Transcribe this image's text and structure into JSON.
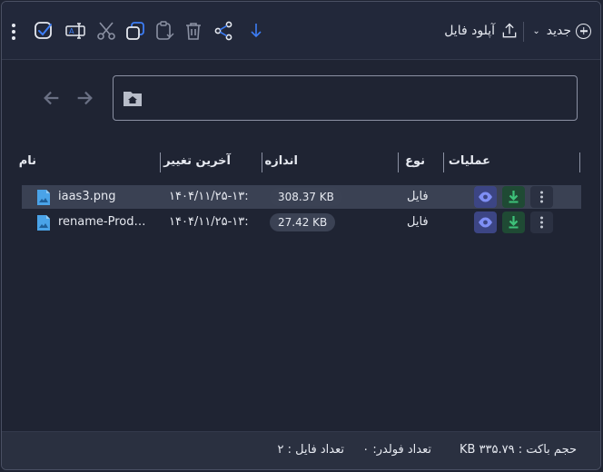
{
  "toolbar": {
    "new_label": "جدید",
    "upload_label": "آپلود فایل",
    "icons": [
      "more-vertical-icon",
      "select-all-icon",
      "rename-icon",
      "cut-icon",
      "copy-icon",
      "paste-icon",
      "delete-icon",
      "share-icon",
      "download-icon",
      "upload-icon",
      "plus-circle-icon",
      "chevron-down-icon"
    ]
  },
  "path": {
    "icon": "folder-home-icon"
  },
  "table": {
    "headers": {
      "name": "نام",
      "modified": "آخرین تغییر",
      "size": "اندازه",
      "type": "نوع",
      "actions": "عملیات"
    },
    "rows": [
      {
        "name": "iaas3.png",
        "modified": "۱۴۰۴/۱۱/۲۵-۱۳:",
        "size": "308.37 KB",
        "type": "فایل",
        "selected": true
      },
      {
        "name": "rename-Produ…",
        "modified": "۱۴۰۴/۱۱/۲۵-۱۳:",
        "size": "27.42 KB",
        "type": "فایل",
        "selected": false
      }
    ]
  },
  "footer": {
    "bucket_size": "حجم باکت : KB ۳۳۵.۷۹",
    "folder_count": "تعداد فولدر: ۰",
    "file_count": "تعداد فایل : ۲"
  },
  "colors": {
    "background": "#1f2433",
    "toolbar": "#22283a",
    "selected_row": "#3a4153",
    "accent_blue": "#3d7df5",
    "view_button": "#3c4584",
    "download_button": "#1f4a34",
    "download_icon": "#3ec27a"
  }
}
